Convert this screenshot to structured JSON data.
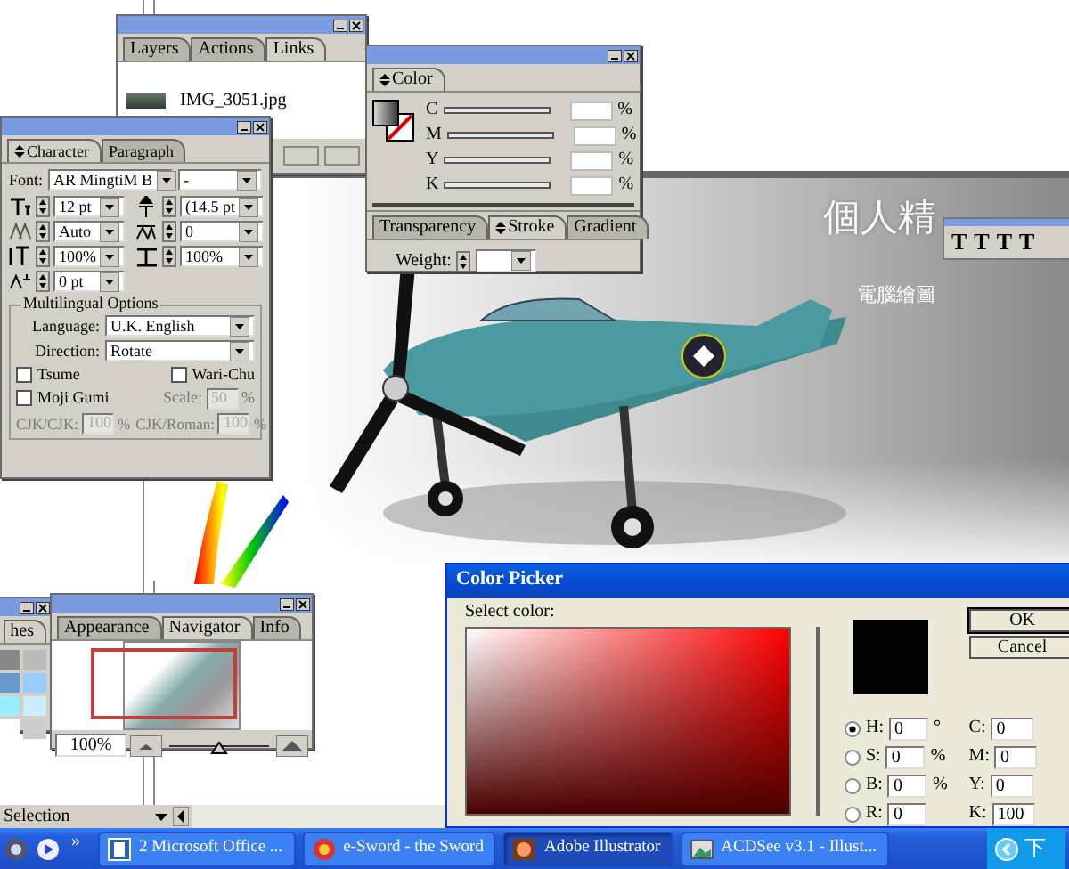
{
  "artwork": {
    "title": "個人精",
    "subtitle": "電腦繪圖"
  },
  "type_toolbar": {
    "tools": [
      "T",
      "T",
      "T",
      "T"
    ]
  },
  "layers_panel": {
    "tabs": [
      {
        "label": "Layers",
        "selected": false
      },
      {
        "label": "Actions",
        "selected": false
      },
      {
        "label": "Links",
        "selected": true
      }
    ],
    "items": [
      {
        "name": "IMG_3051.jpg"
      }
    ]
  },
  "character_panel": {
    "tabs": [
      {
        "label": "Character",
        "selected": true
      },
      {
        "label": "Paragraph",
        "selected": false
      }
    ],
    "font_label": "Font:",
    "font": "AR MingtiM B",
    "font_style": "-",
    "fields": [
      {
        "kind": "size",
        "value": "12 pt"
      },
      {
        "kind": "leading",
        "value": "(14.5 pt"
      },
      {
        "kind": "kerning",
        "value": "Auto"
      },
      {
        "kind": "tracking",
        "value": "0"
      },
      {
        "kind": "vscale",
        "value": "100%"
      },
      {
        "kind": "hscale",
        "value": "100%"
      },
      {
        "kind": "baseline",
        "value": "0 pt"
      }
    ],
    "multilingual": {
      "title": "Multilingual Options",
      "selects": [
        {
          "label": "Language:",
          "value": "U.K. English"
        },
        {
          "label": "Direction:",
          "value": "Rotate"
        }
      ],
      "checks": [
        {
          "label": "Tsume",
          "checked": false
        },
        {
          "label": "Wari-Chu",
          "checked": false
        },
        {
          "label": "Moji Gumi",
          "checked": false
        }
      ],
      "spacing": [
        {
          "label": "Scale:",
          "value": "50",
          "unit": "%",
          "disabled": true
        },
        {
          "label": "CJK/CJK:",
          "value": "100",
          "unit": "%",
          "disabled": true
        },
        {
          "label": "CJK/Roman:",
          "value": "100",
          "unit": "%",
          "disabled": true
        }
      ]
    }
  },
  "color_panel": {
    "tabs": [
      {
        "label": "Color",
        "selected": true
      }
    ],
    "sliders": [
      {
        "label": "C",
        "unit": "%"
      },
      {
        "label": "M",
        "unit": "%"
      },
      {
        "label": "Y",
        "unit": "%"
      },
      {
        "label": "K",
        "unit": "%"
      }
    ],
    "bottom_tabs": [
      {
        "label": "Transparency",
        "selected": false
      },
      {
        "label": "Stroke",
        "selected": true
      },
      {
        "label": "Gradient",
        "selected": false
      }
    ],
    "weight_label": "Weight:"
  },
  "swatches_panel": {
    "tabs": [
      {
        "label": "hes",
        "selected": true
      }
    ]
  },
  "navigator_panel": {
    "tabs": [
      {
        "label": "Appearance",
        "selected": false
      },
      {
        "label": "Navigator",
        "selected": true
      },
      {
        "label": "Info",
        "selected": false
      }
    ],
    "zoom": "100%",
    "zoom_slider": {
      "level": 0.5
    }
  },
  "status_bar": {
    "tool": "Selection"
  },
  "color_picker": {
    "title": "Color Picker",
    "prompt": "Select color:",
    "buttons": [
      "OK",
      "Cancel"
    ],
    "hsb_fields": [
      {
        "label": "H:",
        "value": "0",
        "unit": "°",
        "selected": true
      },
      {
        "label": "S:",
        "value": "0",
        "unit": "%",
        "selected": false
      },
      {
        "label": "B:",
        "value": "0",
        "unit": "%",
        "selected": false
      },
      {
        "label": "R:",
        "value": "0",
        "selected": false
      }
    ],
    "cmyk_fields": [
      {
        "label": "C:",
        "value": "0"
      },
      {
        "label": "M:",
        "value": "0"
      },
      {
        "label": "Y:",
        "value": "0"
      },
      {
        "label": "K:",
        "value": "100"
      }
    ]
  },
  "taskbar": {
    "more": "»",
    "items": [
      {
        "label": "2 Microsoft Office ...",
        "kind": "word",
        "selected": false
      },
      {
        "label": "e-Sword - the Sword",
        "kind": "sword",
        "selected": false
      },
      {
        "label": "Adobe Illustrator",
        "kind": "illustrator",
        "selected": true
      },
      {
        "label": "ACDSee v3.1 - Illust...",
        "kind": "acdsee",
        "selected": false
      }
    ],
    "tray": "下"
  }
}
